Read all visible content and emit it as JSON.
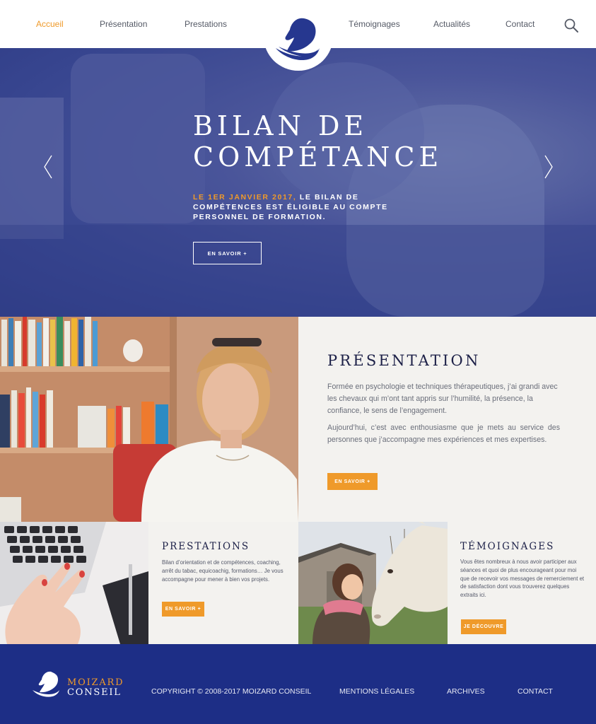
{
  "nav": {
    "items": [
      {
        "label": "Accueil",
        "active": true
      },
      {
        "label": "Présentation"
      },
      {
        "label": "Prestations"
      },
      {
        "label": "Témoignages"
      },
      {
        "label": "Actualités"
      },
      {
        "label": "Contact"
      }
    ],
    "icons": {
      "search": "search-icon",
      "logo": "horse-head-logo"
    }
  },
  "hero": {
    "title_line1": "BILAN DE",
    "title_line2": "COMPÉTANCE",
    "subtitle_highlight": "LE 1ER JANVIER 2017,",
    "subtitle_rest": " LE BILAN DE COMPÉTENCES EST ÉLIGIBLE AU COMPTE PERSONNEL DE FORMATION.",
    "button": "EN SAVOIR +"
  },
  "presentation": {
    "title": "PRÉSENTATION",
    "para1": "Formée en psychologie et techniques thérapeutiques, j’ai grandi avec les chevaux qui m’ont tant appris sur l’humilité, la présence, la confiance, le sens de l’engagement.",
    "para2": "Aujourd’hui, c’est avec enthousiasme que je mets au service des personnes que j’accompagne mes expériences et mes expertises.",
    "button": "EN SAVOIR +"
  },
  "prestations": {
    "title": "PRESTATIONS",
    "text": "Bilan d’orientation et de compétences, coaching, arrêt du tabac, equicoachig, formations… Je vous accompagne pour mener à bien vos projets.",
    "button": "EN SAVOIR +"
  },
  "temoignages": {
    "title": "TÉMOIGNAGES",
    "text": "Vous êtes nombreux à nous avoir participer aux séances et quoi de plus encourageant pour moi que de recevoir vos messages de remerciement et de satisfaction dont vous trouverez quelques extraits ici.",
    "button": "JE DÉCOUVRE"
  },
  "footer": {
    "brand_line1": "MOIZARD",
    "brand_line2": "CONSEIL",
    "copyright": "COPYRIGHT © 2008-2017 MOIZARD CONSEIL",
    "links": [
      "MENTIONS LÉGALES",
      "ARCHIVES",
      "CONTACT"
    ]
  },
  "colors": {
    "accent_orange": "#ef9a2a",
    "navy": "#1d2e86",
    "hero_blue": "#384690",
    "panel_bg": "#f3f2ef"
  }
}
